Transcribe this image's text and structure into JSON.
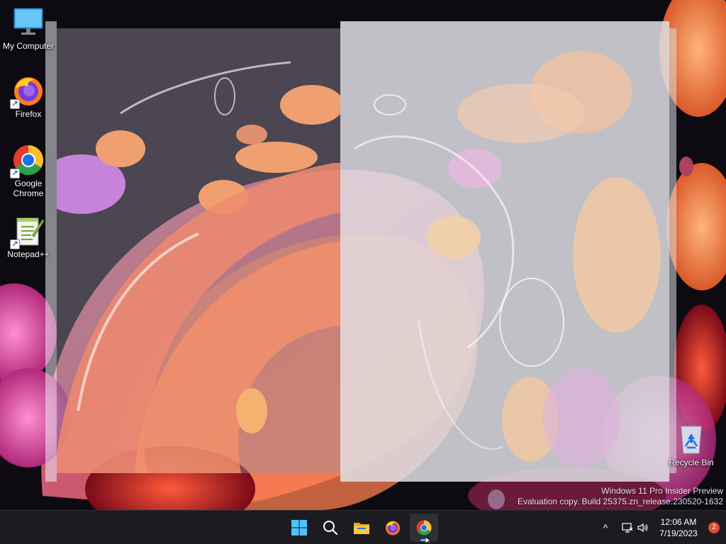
{
  "desktop": {
    "icons": [
      {
        "label": "My Computer",
        "icon": "monitor-icon",
        "shortcut": false
      },
      {
        "label": "Firefox",
        "icon": "firefox-icon",
        "shortcut": true
      },
      {
        "label": "Google Chrome",
        "icon": "chrome-icon",
        "shortcut": true
      },
      {
        "label": "Notepad++",
        "icon": "notepadpp-icon",
        "shortcut": true
      },
      {
        "label": "Recycle Bin",
        "icon": "recycle-bin-icon",
        "shortcut": false
      }
    ],
    "watermark": {
      "line1": "Windows 11 Pro Insider Preview",
      "line2": "Evaluation copy. Build 25375.zn_release.230520-1632"
    }
  },
  "taskbar": {
    "apps": [
      {
        "name": "Start",
        "icon": "windows-start-icon",
        "active": false
      },
      {
        "name": "Search",
        "icon": "search-icon",
        "active": false
      },
      {
        "name": "File Explorer",
        "icon": "folder-icon",
        "active": false
      },
      {
        "name": "Firefox",
        "icon": "firefox-icon",
        "active": false
      },
      {
        "name": "Google Chrome",
        "icon": "chrome-icon",
        "active": true
      }
    ],
    "tray": {
      "chevron": "^",
      "time": "12:06 AM",
      "date": "7/19/2023",
      "notification_count": "2"
    }
  },
  "colors": {
    "taskbar": "#1c1c20",
    "accent": "#5fb2f2",
    "badge": "#e04a3a"
  }
}
